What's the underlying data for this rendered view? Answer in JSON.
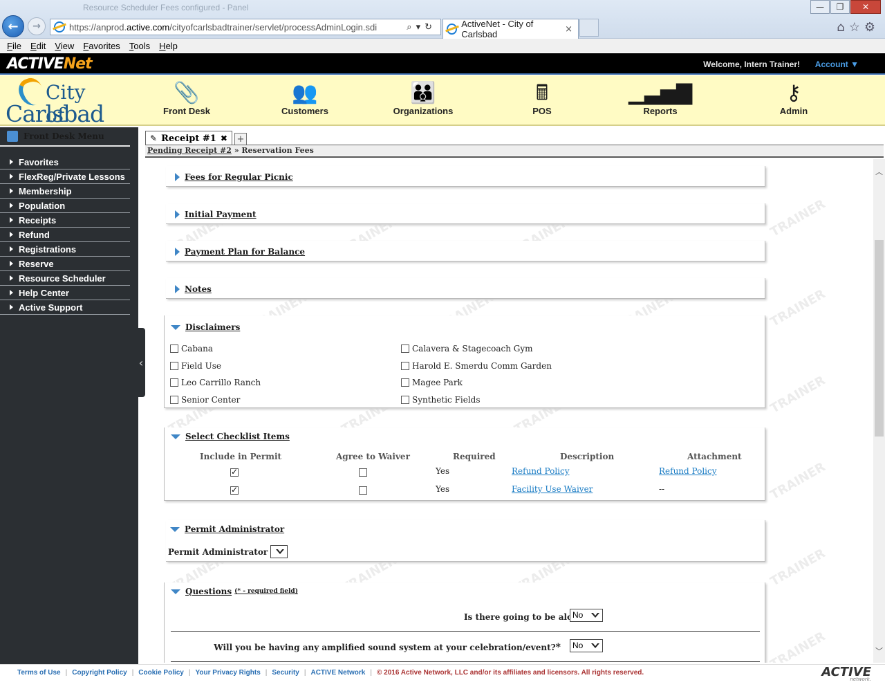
{
  "browser": {
    "faded_title": "Resource Scheduler Fees configured - Panel",
    "url_prefix": "https://anprod.",
    "url_host": "active.com",
    "url_path": "/cityofcarlsbadtrainer/servlet/processAdminLogin.sdi",
    "tab_title": "ActiveNet - City of Carlsbad",
    "tab_close": "×",
    "menu": [
      "File",
      "Edit",
      "View",
      "Favorites",
      "Tools",
      "Help"
    ]
  },
  "header": {
    "logo_active": "ACTIVE",
    "logo_net": "Net",
    "welcome": "Welcome, Intern Trainer!",
    "account": "Account",
    "city_line1": "City of",
    "city_line2": "Carlsbad",
    "nav": [
      {
        "label": "Front Desk",
        "icon": "paperclip-icon"
      },
      {
        "label": "Customers",
        "icon": "customers-icon"
      },
      {
        "label": "Organizations",
        "icon": "organizations-icon"
      },
      {
        "label": "POS",
        "icon": "cash-register-icon"
      },
      {
        "label": "Reports",
        "icon": "bar-chart-icon"
      },
      {
        "label": "Admin",
        "icon": "keys-icon"
      }
    ]
  },
  "sidebar": {
    "title": "Front Desk Menu",
    "items": [
      "Favorites",
      "FlexReg/Private Lessons",
      "Membership",
      "Population",
      "Receipts",
      "Refund",
      "Registrations",
      "Reserve",
      "Resource Scheduler",
      "Help Center",
      "Active Support"
    ]
  },
  "tabs": {
    "receipt": "Receipt #1",
    "pending_receipt": "Pending Receipt #2",
    "breadcrumb_sep": " » ",
    "current": "Reservation Fees"
  },
  "watermark": "TRAINER",
  "sections": {
    "fees": "Fees for Regular Picnic",
    "initial_payment": "Initial Payment",
    "payment_plan": "Payment Plan for Balance",
    "notes": "Notes",
    "disclaimers": "Disclaimers",
    "checklist": "Select Checklist Items",
    "permit_admin": "Permit Administrator",
    "questions": "Questions",
    "questions_note": "(* - required field)"
  },
  "disclaimers": [
    {
      "label": "Cabana",
      "checked": false
    },
    {
      "label": "Calavera & Stagecoach Gym",
      "checked": false
    },
    {
      "label": "Field Use",
      "checked": false
    },
    {
      "label": "Harold E. Smerdu Comm Garden",
      "checked": false
    },
    {
      "label": "Leo Carrillo Ranch",
      "checked": false
    },
    {
      "label": "Magee Park",
      "checked": false
    },
    {
      "label": "Senior Center",
      "checked": false
    },
    {
      "label": "Synthetic Fields",
      "checked": false
    }
  ],
  "checklist": {
    "headers": [
      "Include in Permit",
      "Agree to Waiver",
      "Required",
      "Description",
      "Attachment"
    ],
    "rows": [
      {
        "include": true,
        "agree": false,
        "required": "Yes",
        "description": "Refund Policy",
        "attachment": "Refund Policy"
      },
      {
        "include": true,
        "agree": false,
        "required": "Yes",
        "description": "Facility Use Waiver",
        "attachment": "--"
      }
    ]
  },
  "permit_admin": {
    "label": "Permit Administrator",
    "value": ""
  },
  "questions": [
    {
      "text": "Is there going to be alcohol?",
      "required_mark": "*",
      "value": "No"
    },
    {
      "text": "Will you be having any amplified sound system at your celebration/event?",
      "required_mark": "*",
      "value": "No"
    }
  ],
  "footer": {
    "links": [
      "Terms of Use",
      "Copyright Policy",
      "Cookie Policy",
      "Your Privacy Rights",
      "Security",
      "ACTIVE Network"
    ],
    "copyright": "© 2016 Active Network, LLC and/or its affiliates and licensors. All rights reserved.",
    "logo": "ACTIVE",
    "logo_sub": "network."
  },
  "colors": {
    "nav_background": "#fffbc4",
    "sidebar_background": "#2b2f33",
    "link": "#1a7cc4",
    "section_triangle": "#3f86c6"
  }
}
